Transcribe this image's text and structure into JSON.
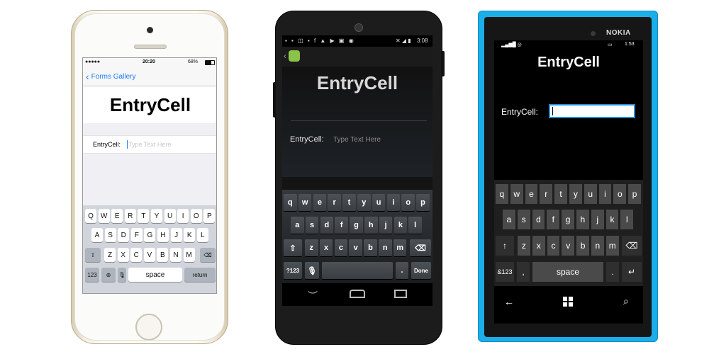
{
  "ios": {
    "status_time": "20:20",
    "status_battery": "68%",
    "back_label": "Forms Gallery",
    "title": "EntryCell",
    "entry_label": "EntryCell:",
    "entry_placeholder": "Type Text Here",
    "keyboard": {
      "row1": [
        "Q",
        "W",
        "E",
        "R",
        "T",
        "Y",
        "U",
        "I",
        "O",
        "P"
      ],
      "row2": [
        "A",
        "S",
        "D",
        "F",
        "G",
        "H",
        "J",
        "K",
        "L"
      ],
      "row3": [
        "Z",
        "X",
        "C",
        "V",
        "B",
        "N",
        "M"
      ],
      "numbers_key": "123",
      "space_key": "space",
      "return_key": "return"
    }
  },
  "android": {
    "status_time": "3:08",
    "title": "EntryCell",
    "entry_label": "EntryCell:",
    "entry_placeholder": "Type Text Here",
    "keyboard": {
      "row1": [
        "q",
        "w",
        "e",
        "r",
        "t",
        "y",
        "u",
        "i",
        "o",
        "p"
      ],
      "row2": [
        "a",
        "s",
        "d",
        "f",
        "g",
        "h",
        "j",
        "k",
        "l"
      ],
      "row3": [
        "z",
        "x",
        "c",
        "v",
        "b",
        "n",
        "m"
      ],
      "symbols_key": "?123",
      "period_key": ".",
      "done_key": "Done"
    }
  },
  "windows_phone": {
    "brand": "NOKIA",
    "status_time": "1:53",
    "title": "EntryCell",
    "entry_label": "EntryCell:",
    "entry_value": "",
    "keyboard": {
      "row1": [
        "q",
        "w",
        "e",
        "r",
        "t",
        "y",
        "u",
        "i",
        "o",
        "p"
      ],
      "row2": [
        "a",
        "s",
        "d",
        "f",
        "g",
        "h",
        "j",
        "k",
        "l"
      ],
      "row3": [
        "z",
        "x",
        "c",
        "v",
        "b",
        "n",
        "m"
      ],
      "symbols_key": "&123",
      "comma_key": ",",
      "space_key": "space",
      "period_key": "."
    }
  }
}
